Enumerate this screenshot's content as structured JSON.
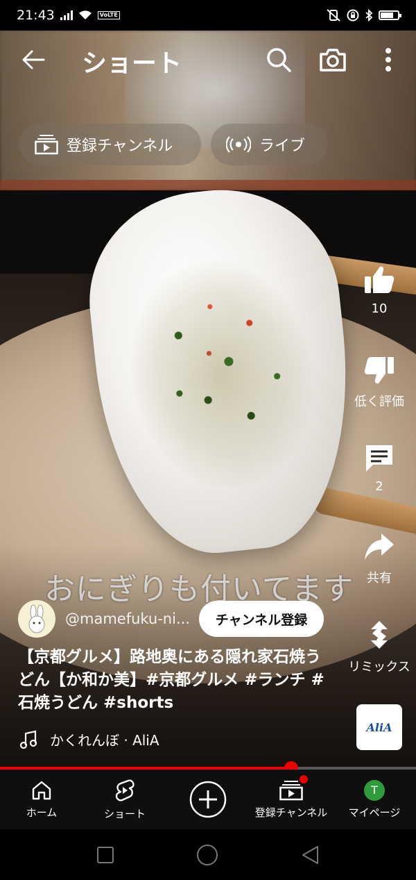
{
  "status_bar": {
    "time": "21:43",
    "volte_label": "Vo\nLTE",
    "battery_level": 0.75,
    "icons": [
      "signal-icon",
      "wifi-icon",
      "volte-icon",
      "vibrate-off-icon",
      "lock-rotation-icon",
      "bluetooth-icon",
      "battery-icon"
    ]
  },
  "header": {
    "title": "ショート",
    "icons": [
      "back-arrow-icon",
      "search-icon",
      "camera-icon",
      "more-vert-icon"
    ]
  },
  "chips": {
    "subscriptions": "登録チャンネル",
    "live": "ライブ"
  },
  "video": {
    "caption": "おにぎりも付いてます",
    "channel_handle": "@mamefuku-ni...",
    "subscribe_label": "チャンネル登録",
    "title": "【京都グルメ】路地奥にある隠れ家石焼うどん【か和か美】#京都グルメ #ランチ #石焼うどん #shorts",
    "music": "かくれんぼ · AliA",
    "progress": 0.7
  },
  "actions": {
    "like_count": "10",
    "dislike_label": "低く評価",
    "comment_count": "2",
    "share_label": "共有",
    "remix_label": "リミックス",
    "sound_thumb_text": "AliA"
  },
  "bottom_nav": {
    "home": "ホーム",
    "shorts": "ショート",
    "subscriptions": "登録チャンネル",
    "you": "マイページ",
    "you_initial": "T"
  },
  "colors": {
    "accent_red": "#ff0000",
    "nav_bg": "#0f0f0f",
    "you_avatar": "#2e9c3a"
  }
}
